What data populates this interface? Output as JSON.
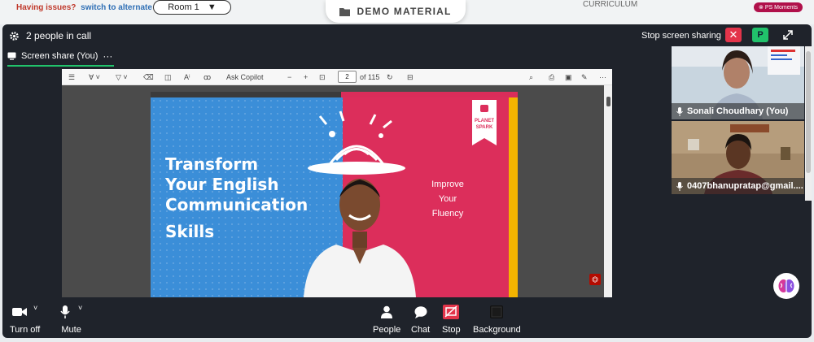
{
  "top": {
    "issues_text": "Having issues?",
    "alternate_link": "switch to alternate room",
    "room_select": "Room 1",
    "demo_material": "DEMO MATERIAL",
    "curriculum": "CURRICULUM",
    "moments_badge": "PS Moments"
  },
  "call": {
    "people_count": "2 people in call",
    "stop_sharing_label": "Stop screen sharing",
    "avatar_letter": "P",
    "share_tab": "Screen share (You)",
    "share_more": "···"
  },
  "pdf": {
    "ask_copilot": "Ask Copilot",
    "zoom_out": "−",
    "zoom_in": "+",
    "page_number": "2",
    "page_total": "of 115"
  },
  "slide": {
    "title_lines": [
      "Transform",
      "Your English",
      "Communication"
    ],
    "subtitle": "Skills",
    "side_lines": [
      "Improve",
      "Your",
      "Fluency"
    ],
    "brand_line1": "PLANET",
    "brand_line2": "SPARK"
  },
  "participants": [
    {
      "name": "Sonali Choudhary (You)",
      "bg": "#c7d4de"
    },
    {
      "name": "0407bhanupratap@gmail....",
      "bg": "#a98f6e"
    }
  ],
  "controls": {
    "camera": "Turn off",
    "mic": "Mute",
    "people": "People",
    "chat": "Chat",
    "stop": "Stop",
    "background": "Background"
  },
  "colors": {
    "accent_green": "#21c26b",
    "stop_red": "#e3344a",
    "call_bg": "#1f232b",
    "slide_blue": "#3b8ed8",
    "slide_pink": "#dc2e5b",
    "slide_yellow": "#f4b400"
  },
  "icons": [
    "gear-icon",
    "fullscreen-icon",
    "screen-share-icon",
    "camera-icon",
    "microphone-icon",
    "people-icon",
    "chat-icon",
    "stop-share-icon",
    "background-icon",
    "brain-icon",
    "folder-icon",
    "pdf-icon"
  ]
}
